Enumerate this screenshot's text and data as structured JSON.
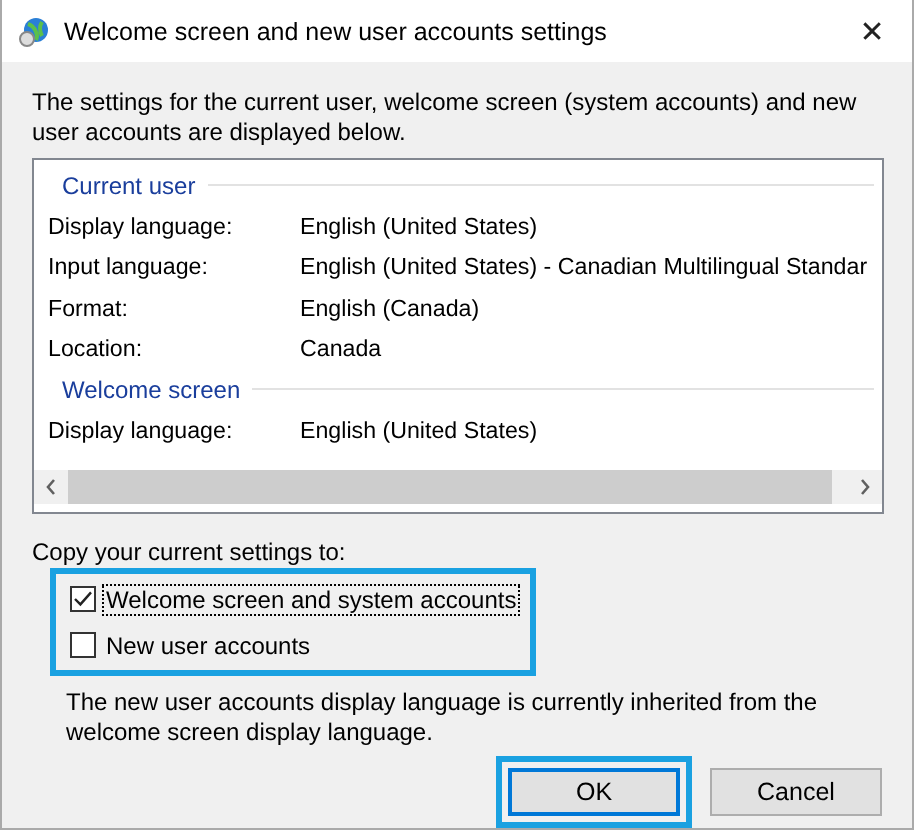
{
  "window": {
    "title": "Welcome screen and new user accounts settings",
    "close": "✕"
  },
  "intro": "The settings for the current user, welcome screen (system accounts) and new user accounts are displayed below.",
  "settings_list": {
    "groups": [
      {
        "header": "Current user",
        "rows": [
          {
            "label": "Display language:",
            "value": "English (United States)"
          },
          {
            "label": "Input language:",
            "value": "English (United States) - Canadian Multilingual Standar"
          },
          {
            "label": "Format:",
            "value": "English (Canada)"
          },
          {
            "label": "Location:",
            "value": "Canada"
          }
        ]
      },
      {
        "header": "Welcome screen",
        "rows": [
          {
            "label": "Display language:",
            "value": "English (United States)"
          }
        ]
      }
    ]
  },
  "copy_label": "Copy your current settings to:",
  "copy_options": {
    "highlighted": true,
    "items": [
      {
        "label": "Welcome screen and system accounts",
        "checked": true,
        "focused": true
      },
      {
        "label": "New user accounts",
        "checked": false,
        "focused": false
      }
    ]
  },
  "note": "The new user accounts display language is currently inherited from the welcome screen display language.",
  "buttons": [
    {
      "label": "OK",
      "default": true,
      "highlighted": true
    },
    {
      "label": "Cancel",
      "default": false,
      "highlighted": false
    }
  ]
}
